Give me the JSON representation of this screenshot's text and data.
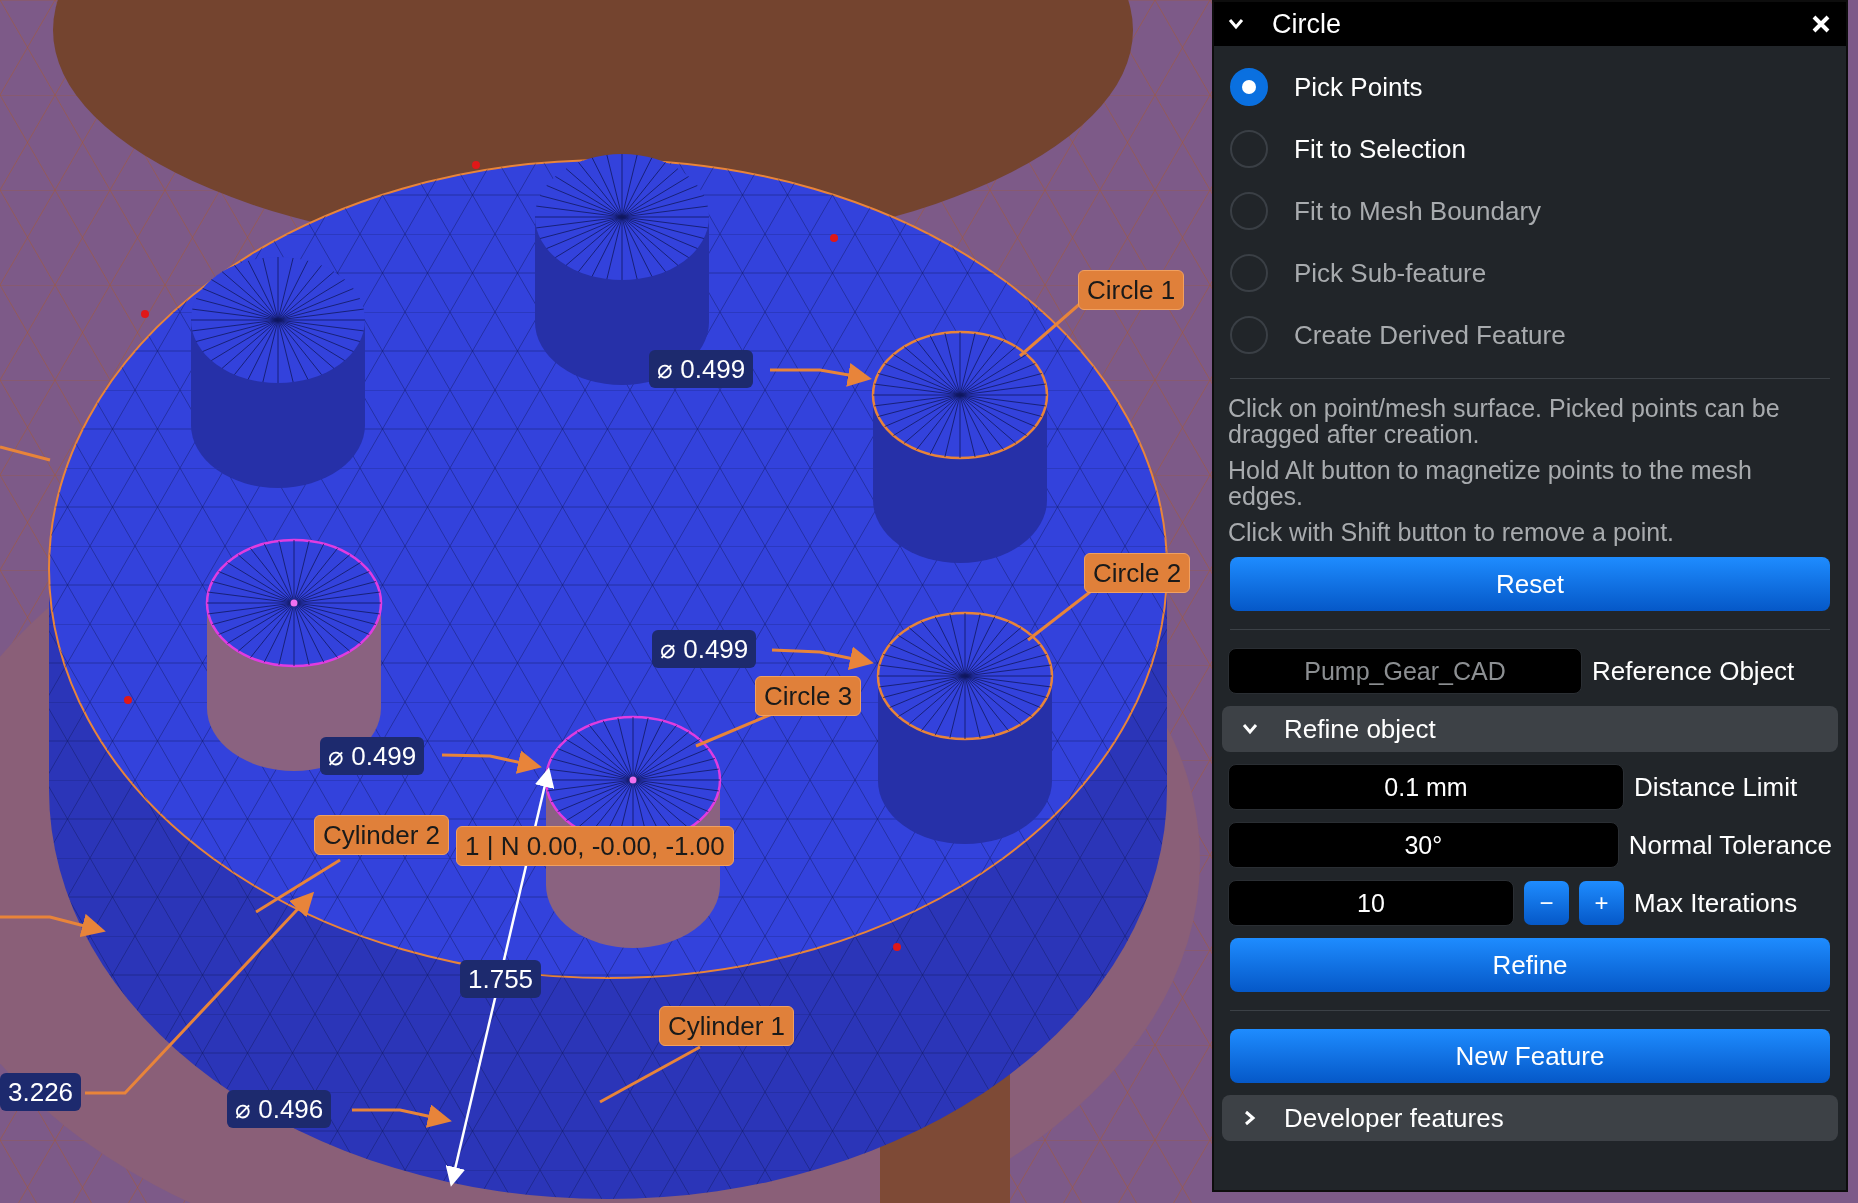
{
  "viewport": {
    "labels": [
      {
        "kind": "feature",
        "text": "Circle 1"
      },
      {
        "kind": "measure",
        "text": "⌀ 0.499"
      },
      {
        "kind": "feature",
        "text": "Circle 2"
      },
      {
        "kind": "measure",
        "text": "⌀ 0.499"
      },
      {
        "kind": "feature",
        "text": "Circle 3"
      },
      {
        "kind": "measure",
        "text": "⌀ 0.499"
      },
      {
        "kind": "feature",
        "text": "Cylinder 2"
      },
      {
        "kind": "feature",
        "text": "1  |  N 0.00, -0.00, -1.00"
      },
      {
        "kind": "measure",
        "text": "1.755"
      },
      {
        "kind": "feature",
        "text": "Cylinder 1"
      },
      {
        "kind": "measure",
        "text": "3.226"
      },
      {
        "kind": "measure",
        "text": "⌀ 0.496"
      }
    ]
  },
  "panel": {
    "title": "Circle",
    "expanded": true,
    "modes": [
      {
        "label": "Pick Points",
        "selected": true,
        "disabled": false
      },
      {
        "label": "Fit to Selection",
        "selected": false,
        "disabled": false
      },
      {
        "label": "Fit to Mesh Boundary",
        "selected": false,
        "disabled": true
      },
      {
        "label": "Pick Sub-feature",
        "selected": false,
        "disabled": true
      },
      {
        "label": "Create Derived Feature",
        "selected": false,
        "disabled": true
      }
    ],
    "help": [
      "Click on point/mesh surface. Picked points can be dragged after creation.",
      "Hold Alt button to magnetize points to the mesh edges.",
      "Click with Shift button to remove a point."
    ],
    "reset_button": "Reset",
    "reference_object": {
      "value": "Pump_Gear_CAD",
      "label": "Reference Object",
      "disabled": true
    },
    "refine_section": {
      "title": "Refine object",
      "expanded": true,
      "fields": [
        {
          "kind": "text",
          "value": "0.1 mm",
          "label": "Distance Limit"
        },
        {
          "kind": "text",
          "value": "30°",
          "label": "Normal Tolerance"
        },
        {
          "kind": "stepper",
          "value": "10",
          "label": "Max Iterations",
          "minus": "−",
          "plus": "+"
        }
      ],
      "button": "Refine"
    },
    "new_feature_button": "New Feature",
    "developer_section": {
      "title": "Developer features",
      "expanded": false
    }
  }
}
